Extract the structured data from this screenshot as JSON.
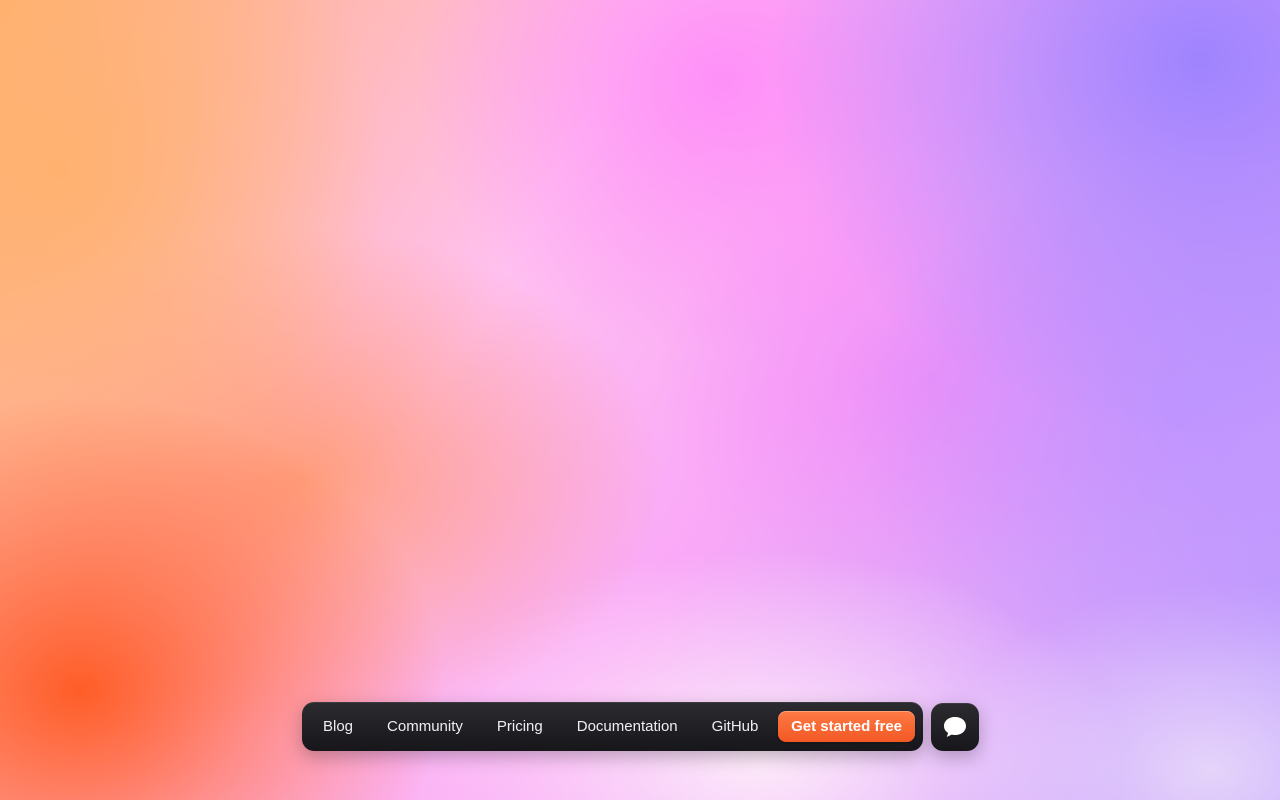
{
  "nav": {
    "links": [
      {
        "label": "Blog"
      },
      {
        "label": "Community"
      },
      {
        "label": "Pricing"
      },
      {
        "label": "Documentation"
      },
      {
        "label": "GitHub"
      }
    ],
    "cta_label": "Get started free"
  },
  "chat": {
    "icon": "chat-bubble-icon"
  },
  "colors": {
    "accent": "#f25824",
    "navbar_bg": "#1e1d21",
    "gradient_orange": "#ff5a1f",
    "gradient_pink": "#ff9cf5",
    "gradient_purple": "#9c87ff"
  }
}
